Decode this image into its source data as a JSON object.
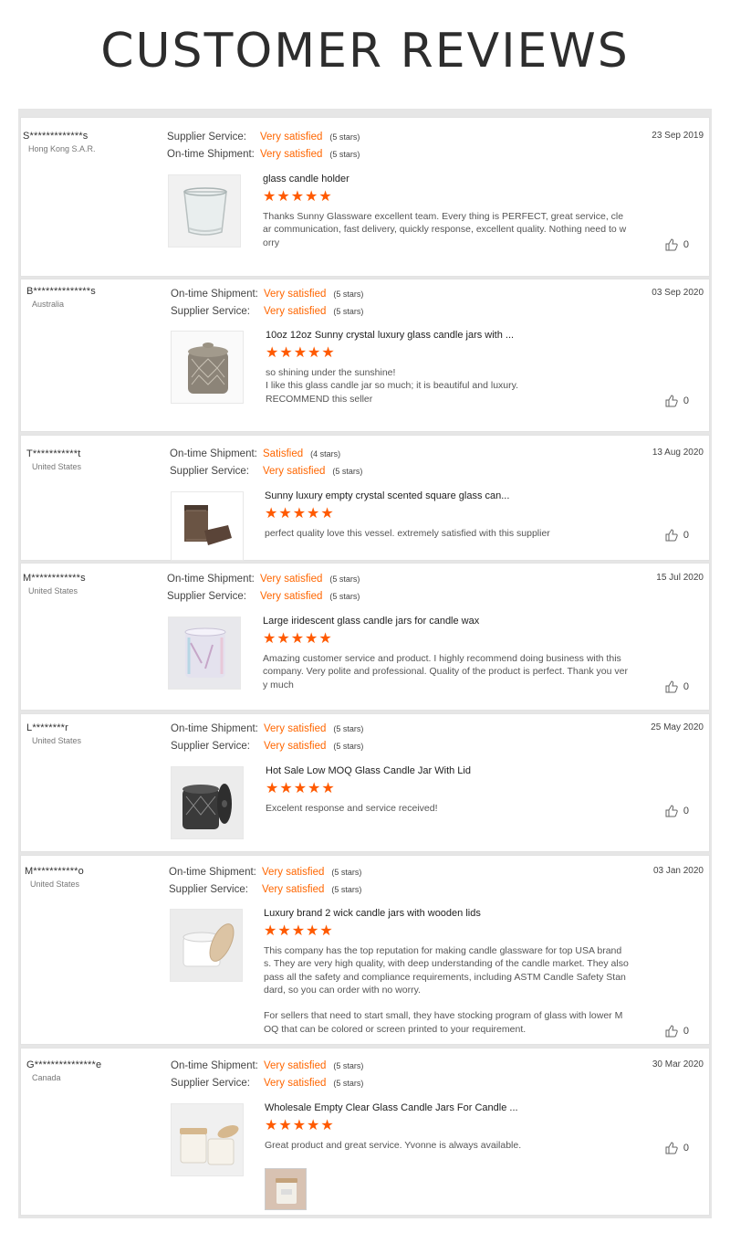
{
  "page": {
    "title": "CUSTOMER REVIEWS"
  },
  "reviews": [
    {
      "name": "S*************s",
      "country": "Hong Kong S.A.R.",
      "date": "23 Sep 2019",
      "ratings": [
        {
          "label": "Supplier Service:",
          "value": "Very satisfied",
          "stars": "(5 stars)"
        },
        {
          "label": "On-time Shipment:",
          "value": "Very satisfied",
          "stars": "(5 stars)"
        }
      ],
      "product": "glass candle holder",
      "star_count": 5,
      "stars_text": "★★★★★",
      "comment": "Thanks Sunny Glassware excellent team. Every thing is PERFECT, great service, clear communication, fast delivery, quickly response, excellent quality. Nothing need to worry",
      "likes": "0",
      "image_icon": "clear-glass-holder-icon"
    },
    {
      "name": "B**************s",
      "country": "Australia",
      "date": "03 Sep 2020",
      "ratings": [
        {
          "label": "On-time Shipment:",
          "value": "Very satisfied",
          "stars": "(5 stars)"
        },
        {
          "label": "Supplier Service:",
          "value": "Very satisfied",
          "stars": "(5 stars)"
        }
      ],
      "product": "10oz 12oz Sunny crystal luxury glass candle jars with ...",
      "star_count": 5,
      "stars_text": "★★★★★",
      "comment": "so shining under the sunshine!\nI like this glass candle jar so much; it is beautiful and luxury.\nRECOMMEND this seller",
      "likes": "0",
      "image_icon": "crystal-jar-icon"
    },
    {
      "name": "T***********t",
      "country": "United States",
      "date": "13 Aug 2020",
      "ratings": [
        {
          "label": "On-time Shipment:",
          "value": "Satisfied",
          "stars": "(4 stars)"
        },
        {
          "label": "Supplier Service:",
          "value": "Very satisfied",
          "stars": "(5 stars)"
        }
      ],
      "product": "Sunny luxury empty crystal scented square glass can...",
      "star_count": 5,
      "stars_text": "★★★★★",
      "comment": "perfect quality love this vessel. extremely satisfied with this supplier",
      "likes": "0",
      "image_icon": "square-glass-icon"
    },
    {
      "name": "M************s",
      "country": "United States",
      "date": "15 Jul 2020",
      "ratings": [
        {
          "label": "On-time Shipment:",
          "value": "Very satisfied",
          "stars": "(5 stars)"
        },
        {
          "label": "Supplier Service:",
          "value": "Very satisfied",
          "stars": "(5 stars)"
        }
      ],
      "product": "Large iridescent glass candle jars for candle wax",
      "star_count": 5,
      "stars_text": "★★★★★",
      "comment": "Amazing customer service and product. I highly recommend doing business with this company. Very polite and professional. Quality of the product is perfect. Thank you very much",
      "likes": "0",
      "image_icon": "iridescent-jar-icon"
    },
    {
      "name": "L********r",
      "country": "United States",
      "date": "25 May 2020",
      "ratings": [
        {
          "label": "On-time Shipment:",
          "value": "Very satisfied",
          "stars": "(5 stars)"
        },
        {
          "label": "Supplier Service:",
          "value": "Very satisfied",
          "stars": "(5 stars)"
        }
      ],
      "product": "Hot Sale Low MOQ Glass Candle Jar With Lid",
      "star_count": 5,
      "stars_text": "★★★★★",
      "comment": "Excelent response and service received!",
      "likes": "0",
      "image_icon": "dark-lidded-jar-icon"
    },
    {
      "name": "M***********o",
      "country": "United States",
      "date": "03 Jan 2020",
      "ratings": [
        {
          "label": "On-time Shipment:",
          "value": "Very satisfied",
          "stars": "(5 stars)"
        },
        {
          "label": "Supplier Service:",
          "value": "Very satisfied",
          "stars": "(5 stars)"
        }
      ],
      "product": "Luxury brand 2 wick candle jars with wooden lids",
      "star_count": 5,
      "stars_text": "★★★★★",
      "comment": "This company has the top reputation for making candle glassware for top USA brands. They are very high quality, with deep understanding of the candle market. They also pass all the safety and compliance requirements, including ASTM Candle Safety Standard, so you can order with no worry.\n\nFor sellers that need to start small, they have stocking program of glass with lower MOQ that can be colored or screen printed to your requirement.",
      "likes": "0",
      "image_icon": "white-jar-wood-lid-icon"
    },
    {
      "name": "G***************e",
      "country": "Canada",
      "date": "30 Mar 2020",
      "ratings": [
        {
          "label": "On-time Shipment:",
          "value": "Very satisfied",
          "stars": "(5 stars)"
        },
        {
          "label": "Supplier Service:",
          "value": "Very satisfied",
          "stars": "(5 stars)"
        }
      ],
      "product": "Wholesale Empty Clear Glass Candle Jars For Candle ...",
      "star_count": 5,
      "stars_text": "★★★★★",
      "comment": "Great product and great service. Yvonne is always available.",
      "likes": "0",
      "image_icon": "clear-jars-wood-lid-icon"
    }
  ],
  "colors": {
    "accent": "#ff6600",
    "star": "#ff5a00",
    "frame": "#e6e6e6"
  }
}
